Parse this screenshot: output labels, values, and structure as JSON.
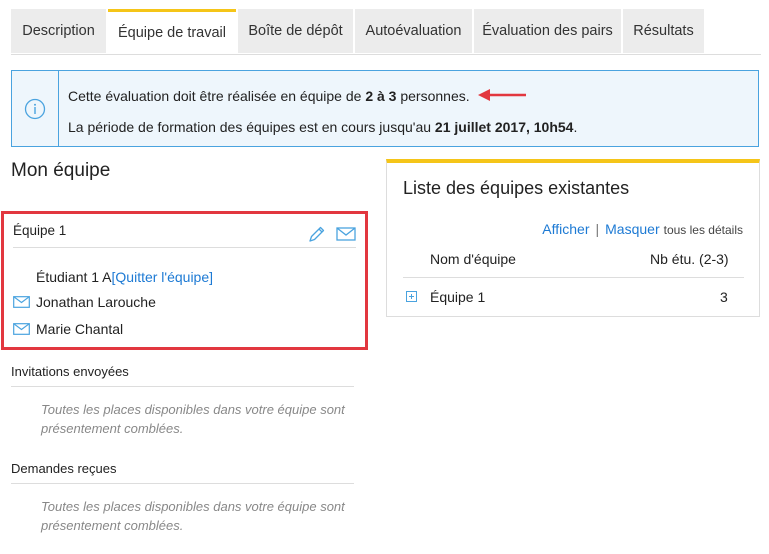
{
  "tabs": [
    {
      "label": "Description",
      "active": false
    },
    {
      "label": "Équipe de travail",
      "active": true
    },
    {
      "label": "Boîte de dépôt",
      "active": false
    },
    {
      "label": "Autoévaluation",
      "active": false
    },
    {
      "label": "Évaluation des pairs",
      "active": false
    },
    {
      "label": "Résultats",
      "active": false
    }
  ],
  "info": {
    "line1_prefix": "Cette évaluation doit être réalisée en équipe de ",
    "line1_bold": "2 à 3",
    "line1_suffix": " personnes.",
    "line2_prefix": "La période de formation des équipes est en cours jusqu'au ",
    "line2_bold": "21 juillet 2017, 10h54",
    "line2_suffix": "."
  },
  "my_team": {
    "heading": "Mon équipe",
    "team_name": "Équipe 1",
    "current_student": "Étudiant 1 A ",
    "quit_link": "[Quitter l'équipe]",
    "members": [
      "Jonathan Larouche",
      "Marie Chantal"
    ]
  },
  "invitations": {
    "heading": "Invitations envoyées",
    "message": "Toutes les places disponibles dans votre équipe sont présentement comblées."
  },
  "requests": {
    "heading": "Demandes reçues",
    "message": "Toutes les places disponibles dans votre équipe sont présentement comblées."
  },
  "teams_list": {
    "title": "Liste des équipes existantes",
    "show_label": "Afficher",
    "separator": "|",
    "hide_label": "Masquer",
    "details_label": "tous les détails",
    "col_name": "Nom d'équipe",
    "col_count": "Nb étu. (2-3)",
    "rows": [
      {
        "name": "Équipe 1",
        "count": "3"
      }
    ]
  },
  "colors": {
    "accent_yellow": "#f5c518",
    "info_blue": "#4aa3df",
    "link_blue": "#1d7ad4",
    "highlight_red": "#e2373f"
  }
}
